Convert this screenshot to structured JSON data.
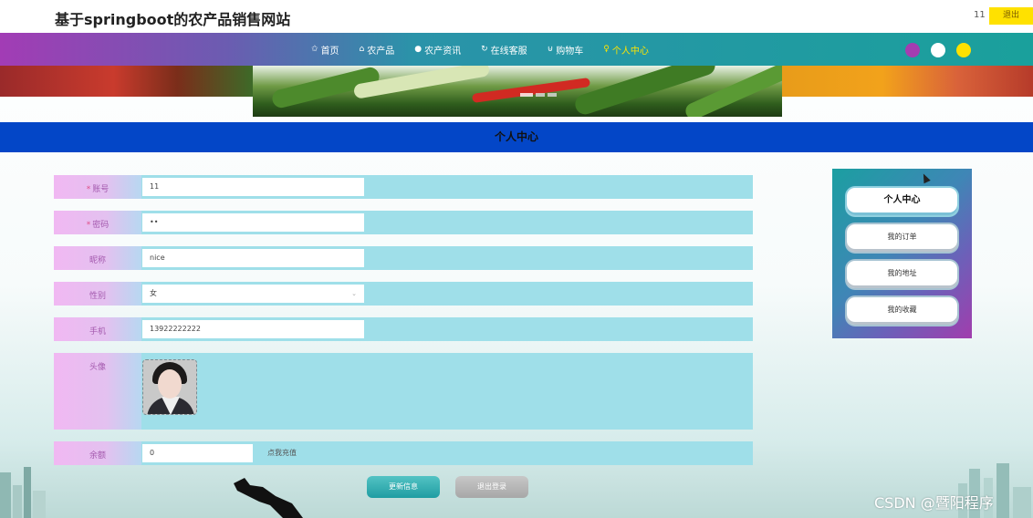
{
  "header": {
    "site_title": "基于springboot的农产品销售网站",
    "username": "11",
    "logout_label": "退出"
  },
  "nav": {
    "items": [
      {
        "icon": "star-icon",
        "glyph": "✩",
        "label": "首页"
      },
      {
        "icon": "home-icon",
        "glyph": "⌂",
        "label": "农产品"
      },
      {
        "icon": "info-icon",
        "glyph": "●",
        "label": "农产资讯"
      },
      {
        "icon": "headset-icon",
        "glyph": "↻",
        "label": "在线客服"
      },
      {
        "icon": "cart-icon",
        "glyph": "⊍",
        "label": "购物车"
      },
      {
        "icon": "user-icon",
        "glyph": "♀",
        "label": "个人中心",
        "active": true
      }
    ],
    "theme_colors": [
      "#a43db1",
      "#ffffff",
      "#ffe100"
    ]
  },
  "page": {
    "title": "个人中心"
  },
  "form": {
    "account": {
      "label": "账号",
      "value": "11"
    },
    "password": {
      "label": "密码",
      "value": "••"
    },
    "nickname": {
      "label": "昵称",
      "value": "nice"
    },
    "gender": {
      "label": "性别",
      "value": "女"
    },
    "phone": {
      "label": "手机",
      "value": "13922222222"
    },
    "avatar": {
      "label": "头像"
    },
    "balance": {
      "label": "余额",
      "value": "0",
      "recharge_label": "点我充值"
    },
    "update_label": "更新信息",
    "exit_label": "退出登录"
  },
  "sidebar": {
    "items": [
      {
        "label": "个人中心",
        "active": true
      },
      {
        "label": "我的订单"
      },
      {
        "label": "我的地址"
      },
      {
        "label": "我的收藏"
      }
    ]
  },
  "watermark": "CSDN @暨阳程序",
  "colors": {
    "nav_active": "#ffe400",
    "header_band": "#0346c7",
    "row_bg": "#9fdfe9",
    "logout_bg": "#ffe100"
  }
}
